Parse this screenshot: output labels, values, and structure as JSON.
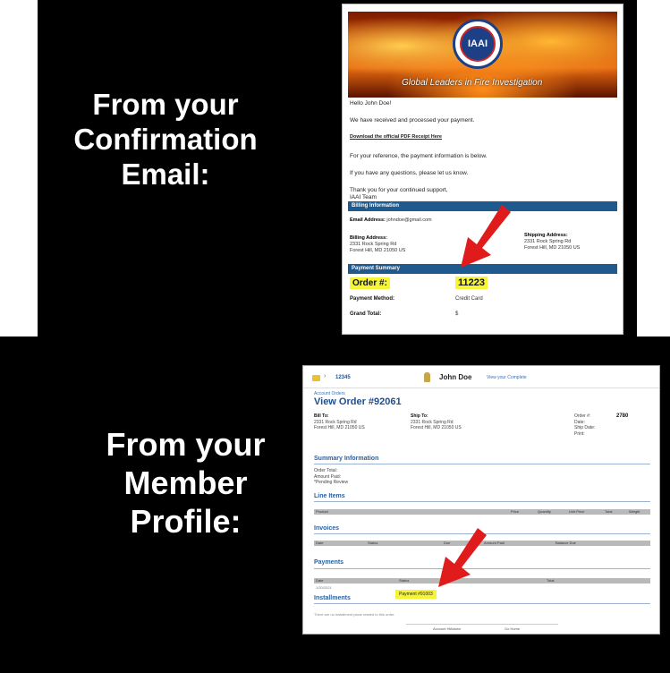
{
  "captions": {
    "top": [
      "From your",
      "Confirmation",
      "Email:"
    ],
    "bottom": [
      "From your",
      "Member",
      "Profile:"
    ]
  },
  "email": {
    "logo_text": "IAAI",
    "tagline": "Global Leaders in Fire Investigation",
    "greeting": "Hello John Doe!",
    "line_received": "We have received and processed your payment.",
    "receipt_link": "Download the official PDF Receipt Here",
    "line_reference": "For your reference, the payment information is below.",
    "line_questions": "If you have any questions, please let us know.",
    "thanks": "Thank you for your continued support,",
    "signature": "IAAI Team",
    "billing_info_header": "Billing Information",
    "email_label": "Email Address:",
    "email_value": "johndoe@gmail.com",
    "billing_address_label": "Billing Address:",
    "billing_address_1": "2331 Rock Spring Rd",
    "billing_address_2": "Forest Hill, MD 21050 US",
    "shipping_address_label": "Shipping Address:",
    "shipping_address_1": "2331 Rock Spring Rd",
    "shipping_address_2": "Forest Hill, MD 21050 US",
    "payment_summary_header": "Payment Summary",
    "order_label": "Order #:",
    "order_value": "11223",
    "payment_method_label": "Payment Method:",
    "payment_method_value": "Credit Card",
    "grand_total_label": "Grand Total:",
    "grand_total_value": "$"
  },
  "profile": {
    "points": "12345",
    "username": "John Doe",
    "profile_link": "View your Complete",
    "breadcrumb": "Account Orders",
    "title": "View Order #92061",
    "bill_to_label": "Bill To:",
    "bill_to_lines": [
      "2331 Rock Spring Rd",
      "Forest Hill, MD 21050 US"
    ],
    "ship_to_label": "Ship To:",
    "ship_to_lines": [
      "2331 Rock Spring Rd",
      "Forest Hill, MD 21050 US"
    ],
    "order_meta_labels": [
      "Order #:",
      "Date:",
      "Ship Date:",
      "Print:"
    ],
    "order_meta_value": "2780",
    "summary_section": "Summary Information",
    "summary_lines": [
      "Order Total:",
      "Amount Paid:",
      "*Pending Review"
    ],
    "line_items_section": "Line Items",
    "line_items_cols": [
      "Product",
      "Price",
      "Quantity",
      "Unit Price",
      "Total",
      "Weight"
    ],
    "invoices_section": "Invoices",
    "invoices_cols": [
      "Date",
      "Status",
      "Due",
      "Amount Paid",
      "Balance Due"
    ],
    "payments_section": "Payments",
    "payments_cols": [
      "Date",
      "Status",
      "Total"
    ],
    "payment_date": "1/20/2021",
    "payment_chip": "Payment #91003",
    "installments_section": "Installments",
    "installments_note": "There are no installment plans related to this order.",
    "tab_left": "Account Hi8down",
    "tab_right": "Go Home"
  },
  "colors": {
    "panel_bg": "#000000",
    "caption_text": "#ffffff",
    "highlight": "#f5f536",
    "email_bar": "#1e5a8e",
    "profile_blue": "#1d4f91",
    "arrow": "#e01b1b"
  }
}
